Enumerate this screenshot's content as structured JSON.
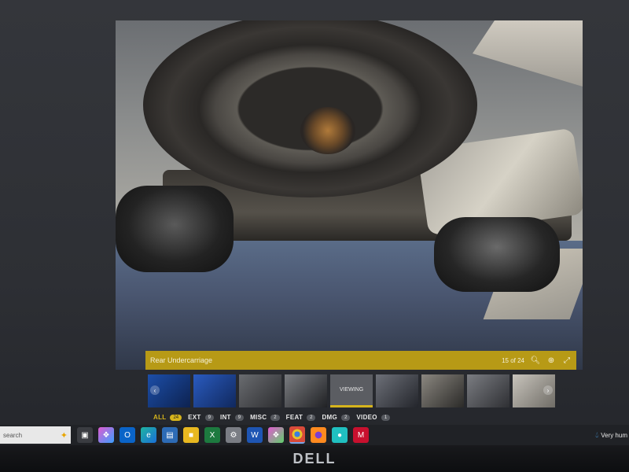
{
  "viewer": {
    "caption_title": "Rear Undercarriage",
    "counter": "15 of 24",
    "icons": [
      "zoom-out-icon",
      "zoom-in-icon",
      "fullscreen-icon"
    ],
    "accent_color": "#d6b41c",
    "caption_bg": "#b79a16"
  },
  "thumbnails": {
    "viewing_label": "VIEWING",
    "count": 9,
    "nav": [
      "prev-arrow-icon",
      "next-arrow-icon"
    ]
  },
  "filters": [
    {
      "label": "ALL",
      "count": "24",
      "active": true
    },
    {
      "label": "EXT",
      "count": "9",
      "active": false
    },
    {
      "label": "INT",
      "count": "9",
      "active": false
    },
    {
      "label": "MISC",
      "count": "2",
      "active": false
    },
    {
      "label": "FEAT",
      "count": "2",
      "active": false
    },
    {
      "label": "DMG",
      "count": "2",
      "active": false
    },
    {
      "label": "VIDEO",
      "count": "1",
      "active": false
    }
  ],
  "taskbar": {
    "search_placeholder": "search",
    "apps": [
      "copilot-icon",
      "outlook-icon",
      "edge-icon",
      "remote-desktop-icon",
      "file-explorer-icon",
      "excel-icon",
      "settings-icon",
      "word-icon",
      "copilot-app-icon",
      "chrome-icon",
      "firefox-icon",
      "teams-icon",
      "mcafee-icon"
    ],
    "weather_text": "Very hum"
  },
  "bezel": {
    "brand": "DELL"
  }
}
